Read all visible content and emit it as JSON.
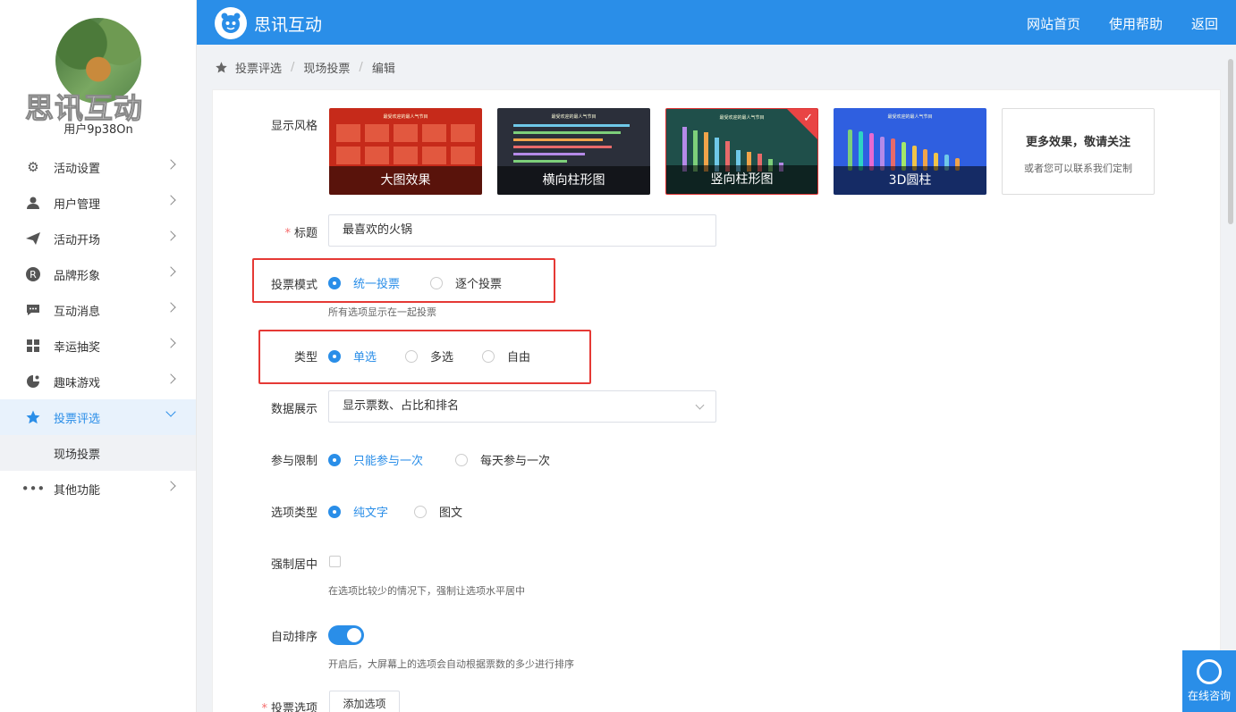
{
  "sidebar": {
    "brand_watermark": "思讯互动",
    "username": "用户9p38On",
    "items": [
      {
        "label": "活动设置",
        "icon": "gear-icon"
      },
      {
        "label": "用户管理",
        "icon": "user-icon"
      },
      {
        "label": "活动开场",
        "icon": "paper-plane-icon"
      },
      {
        "label": "品牌形象",
        "icon": "registered-icon"
      },
      {
        "label": "互动消息",
        "icon": "chat-icon"
      },
      {
        "label": "幸运抽奖",
        "icon": "lottery-icon"
      },
      {
        "label": "趣味游戏",
        "icon": "game-icon"
      },
      {
        "label": "投票评选",
        "icon": "star-icon"
      },
      {
        "label": "其他功能",
        "icon": "more-icon"
      }
    ],
    "submenu": [
      "现场投票"
    ]
  },
  "header": {
    "logo_text": "思讯互动",
    "nav": [
      "网站首页",
      "使用帮助",
      "返回"
    ]
  },
  "breadcrumb": [
    "投票评选",
    "现场投票",
    "编辑"
  ],
  "form": {
    "style_label": "显示风格",
    "styles": [
      {
        "caption": "大图效果",
        "mini_title": "最受欢迎的最人气节目"
      },
      {
        "caption": "横向柱形图",
        "mini_title": "最受欢迎的最人气节目"
      },
      {
        "caption": "竖向柱形图",
        "mini_title": "最受欢迎的最人气节目",
        "selected": true
      },
      {
        "caption": "3D圆柱",
        "mini_title": "最受欢迎的最人气节目"
      }
    ],
    "more": {
      "title": "更多效果，敬请关注",
      "sub": "或者您可以联系我们定制"
    },
    "title_label": "标题",
    "title_value": "最喜欢的火锅",
    "mode_label": "投票模式",
    "mode_options": [
      "统一投票",
      "逐个投票"
    ],
    "mode_hint": "所有选项显示在一起投票",
    "type_label": "类型",
    "type_options": [
      "单选",
      "多选",
      "自由"
    ],
    "display_label": "数据展示",
    "display_value": "显示票数、占比和排名",
    "limit_label": "参与限制",
    "limit_options": [
      "只能参与一次",
      "每天参与一次"
    ],
    "option_type_label": "选项类型",
    "option_type_options": [
      "纯文字",
      "图文"
    ],
    "center_label": "强制居中",
    "center_hint": "在选项比较少的情况下，强制让选项水平居中",
    "sort_label": "自动排序",
    "sort_hint": "开启后，大屏幕上的选项会自动根据票数的多少进行排序",
    "options_label": "投票选项",
    "add_option": "添加选项"
  },
  "float_help": "在线咨询",
  "colors": {
    "primary": "#2a8ee8",
    "highlight_box": "#e53935"
  }
}
